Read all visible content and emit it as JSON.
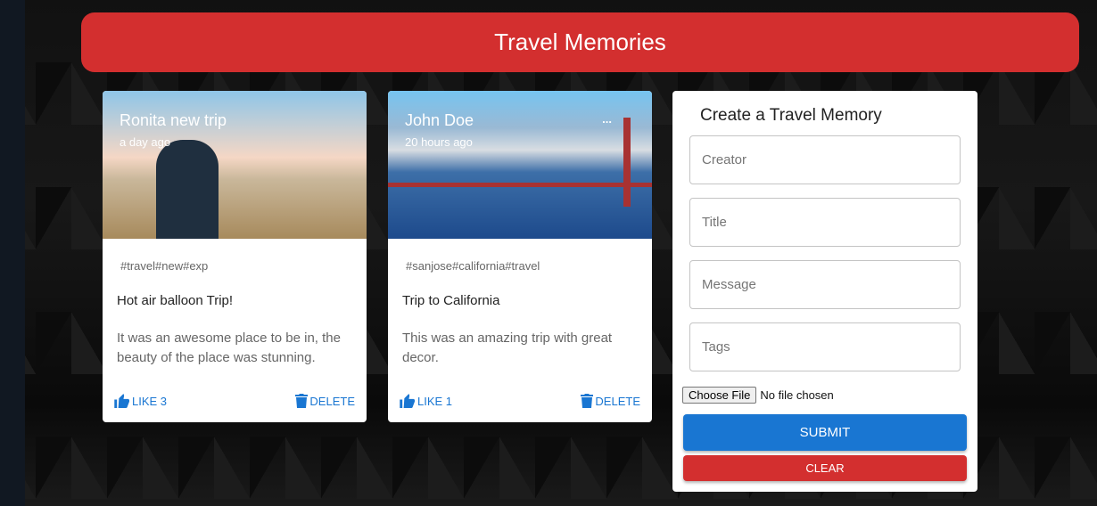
{
  "app": {
    "title": "Travel Memories"
  },
  "posts": [
    {
      "creator": "Ronita new trip",
      "time": "a day ago",
      "tags": "#travel#new#exp",
      "title": "Hot air balloon Trip!",
      "message": "It was an awesome place to be in, the beauty of the place was stunning.",
      "like_label": "LIKE 3",
      "delete_label": "DELETE",
      "more": "..."
    },
    {
      "creator": "John Doe",
      "time": "20 hours ago",
      "tags": "#sanjose#california#travel",
      "title": "Trip to California",
      "message": "This was an amazing trip with great decor.",
      "like_label": "LIKE 1",
      "delete_label": "DELETE",
      "more": "..."
    }
  ],
  "form": {
    "heading": "Create a Travel Memory",
    "creator_placeholder": "Creator",
    "title_placeholder": "Title",
    "message_placeholder": "Message",
    "tags_placeholder": "Tags",
    "choose_file": "Choose File",
    "no_file": "No file chosen",
    "submit": "SUBMIT",
    "clear": "CLEAR"
  },
  "colors": {
    "primary": "#1976d2",
    "secondary": "#d32f2f"
  }
}
